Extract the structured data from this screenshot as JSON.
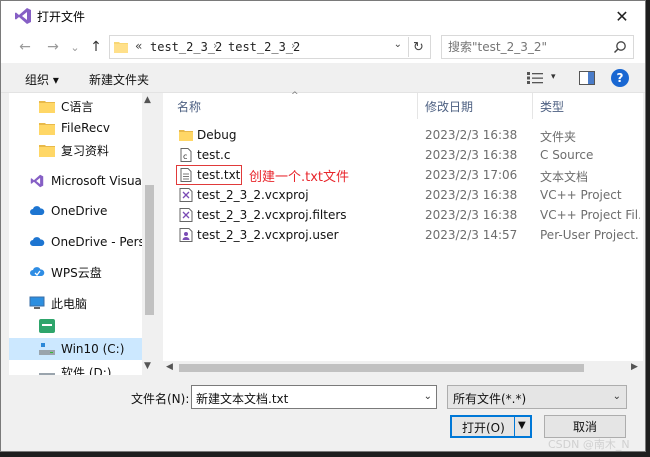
{
  "window": {
    "title": "打开文件",
    "close_glyph": "✕"
  },
  "nav": {
    "back": "←",
    "forward": "→",
    "recent": "⌄",
    "up": "↑",
    "overflow": "«",
    "crumbs": [
      "test_2_3_2",
      "test_2_3_2"
    ],
    "crumb_sep": "›",
    "dropdown": "⌄",
    "refresh": "↻",
    "search_placeholder": "搜索\"test_2_3_2\""
  },
  "toolbar": {
    "organize": "组织 ▾",
    "new_folder": "新建文件夹",
    "view_caret": "▾",
    "help": "?"
  },
  "sidebar": {
    "items": [
      {
        "label": "C语言",
        "icon": "folder-icon"
      },
      {
        "label": "FileRecv",
        "icon": "folder-icon"
      },
      {
        "label": "复习资料",
        "icon": "folder-icon"
      },
      {
        "label": "Microsoft Visual",
        "icon": "visual-studio-icon"
      },
      {
        "label": "OneDrive",
        "icon": "cloud-icon"
      },
      {
        "label": "OneDrive - Perso",
        "icon": "cloud-icon"
      },
      {
        "label": "WPS云盘",
        "icon": "wps-cloud-icon"
      },
      {
        "label": "此电脑",
        "icon": "computer-icon"
      },
      {
        "label": "",
        "icon": "app-icon"
      },
      {
        "label": "Win10 (C:)",
        "icon": "drive-icon"
      },
      {
        "label": "软件 (D:)",
        "icon": "drive-icon"
      }
    ],
    "scroll_up": "▲",
    "scroll_down": "▼"
  },
  "filelist": {
    "columns": {
      "name": "名称",
      "date": "修改日期",
      "type": "类型"
    },
    "sort_indicator": "^",
    "rows": [
      {
        "name": "Debug",
        "date": "2023/2/3 16:38",
        "type": "文件夹",
        "icon": "folder-icon"
      },
      {
        "name": "test.c",
        "date": "2023/2/3 16:38",
        "type": "C Source",
        "icon": "c-source-icon"
      },
      {
        "name": "test.txt",
        "date": "2023/2/3 17:06",
        "type": "文本文档",
        "icon": "text-file-icon"
      },
      {
        "name": "test_2_3_2.vcxproj",
        "date": "2023/2/3 16:38",
        "type": "VC++ Project",
        "icon": "vcxproj-icon"
      },
      {
        "name": "test_2_3_2.vcxproj.filters",
        "date": "2023/2/3 16:38",
        "type": "VC++ Project Fil...",
        "icon": "vcxproj-icon"
      },
      {
        "name": "test_2_3_2.vcxproj.user",
        "date": "2023/2/3 14:57",
        "type": "Per-User Project...",
        "icon": "vcxproj-user-icon"
      }
    ],
    "annotation": "创建一个.txt文件",
    "hscroll_left": "◀",
    "hscroll_right": "▶"
  },
  "bottom": {
    "filename_label": "文件名(N):",
    "filename_value": "新建文本文档.txt",
    "filter_value": "所有文件(*.*)",
    "caret": "⌄",
    "open_label": "打开(O)",
    "open_caret": "▼",
    "cancel_label": "取消"
  },
  "watermark": "CSDN @南木_N"
}
